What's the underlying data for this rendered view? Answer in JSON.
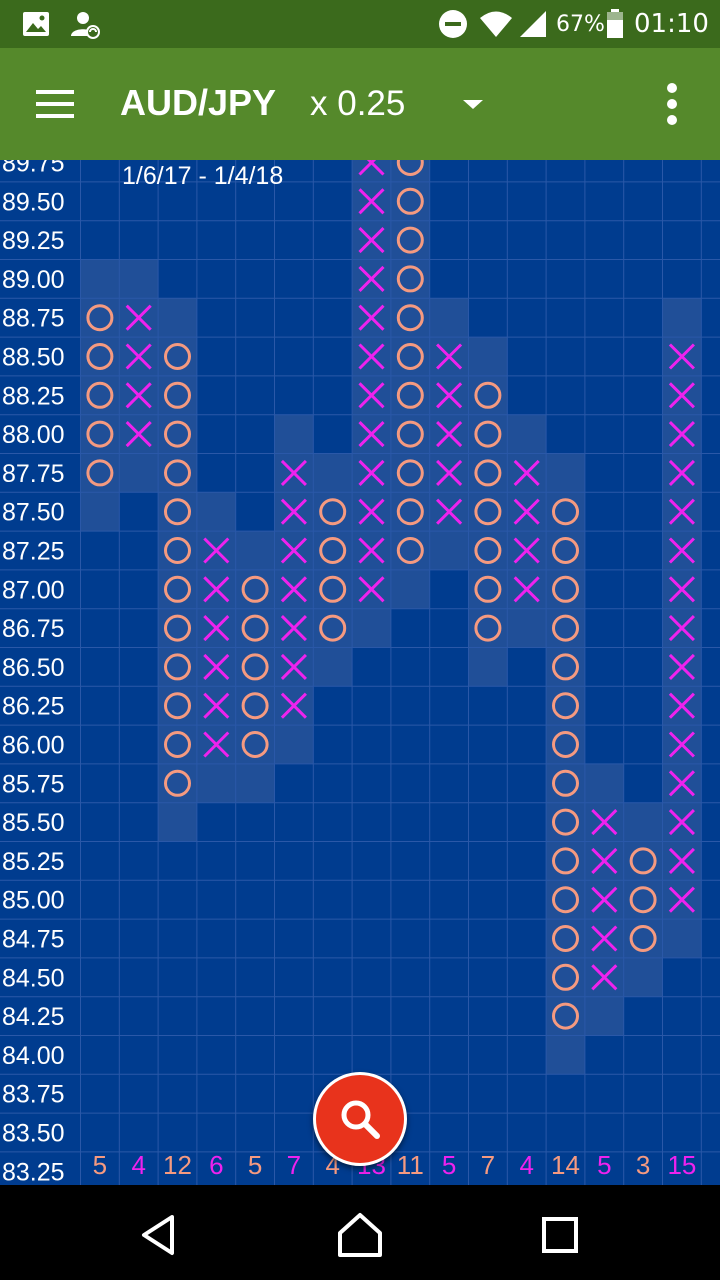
{
  "status_bar": {
    "battery_percent": "67%",
    "time": "01:10",
    "icons": [
      "image-icon",
      "sync-person-icon",
      "dnd-icon",
      "wifi-icon",
      "signal-icon",
      "battery-icon"
    ]
  },
  "app_bar": {
    "symbol": "AUD/JPY",
    "multiplier": "x 0.25",
    "menu_icon": "hamburger-icon",
    "dropdown_icon": "dropdown-arrow-icon",
    "overflow_icon": "more-vert-icon"
  },
  "chart": {
    "date_range": "1/6/17 - 1/4/18",
    "colors": {
      "background": "#003c8f",
      "x_mark": "#ee22ee",
      "o_mark": "#f59a80",
      "highlight": "#3b5fa0",
      "grid": "#2a58a8"
    }
  },
  "chart_data": {
    "type": "point-and-figure",
    "box_size": 0.25,
    "y_labels": [
      "89.75",
      "89.50",
      "89.25",
      "89.00",
      "88.75",
      "88.50",
      "88.25",
      "88.00",
      "87.75",
      "87.50",
      "87.25",
      "87.00",
      "86.75",
      "86.50",
      "86.25",
      "86.00",
      "85.75",
      "85.50",
      "85.25",
      "85.00",
      "84.75",
      "84.50",
      "84.25",
      "84.00",
      "83.75",
      "83.50",
      "83.25"
    ],
    "columns": [
      {
        "type": "O",
        "high": 88.75,
        "low": 87.75,
        "count_label": "5",
        "label_color": "#f59a80"
      },
      {
        "type": "X",
        "high": 88.75,
        "low": 88.0,
        "count_label": "4",
        "label_color": "#ee22ee"
      },
      {
        "type": "O",
        "high": 88.5,
        "low": 85.75,
        "count_label": "12",
        "label_color": "#f59a80"
      },
      {
        "type": "X",
        "high": 87.25,
        "low": 86.0,
        "count_label": "6",
        "label_color": "#ee22ee"
      },
      {
        "type": "O",
        "high": 87.0,
        "low": 86.0,
        "count_label": "5",
        "label_color": "#f59a80"
      },
      {
        "type": "X",
        "high": 87.75,
        "low": 86.25,
        "count_label": "7",
        "label_color": "#ee22ee"
      },
      {
        "type": "O",
        "high": 87.5,
        "low": 86.75,
        "count_label": "4",
        "label_color": "#f59a80"
      },
      {
        "type": "X",
        "high": 89.75,
        "low": 87.0,
        "count_label": "13",
        "label_color": "#ee22ee"
      },
      {
        "type": "O",
        "high": 89.75,
        "low": 87.25,
        "count_label": "11",
        "label_color": "#f59a80"
      },
      {
        "type": "X",
        "high": 88.5,
        "low": 87.5,
        "count_label": "5",
        "label_color": "#ee22ee"
      },
      {
        "type": "O",
        "high": 88.25,
        "low": 86.75,
        "count_label": "7",
        "label_color": "#f59a80"
      },
      {
        "type": "X",
        "high": 87.75,
        "low": 87.0,
        "count_label": "4",
        "label_color": "#ee22ee"
      },
      {
        "type": "O",
        "high": 87.5,
        "low": 84.25,
        "count_label": "14",
        "label_color": "#f59a80"
      },
      {
        "type": "X",
        "high": 85.5,
        "low": 84.5,
        "count_label": "5",
        "label_color": "#ee22ee"
      },
      {
        "type": "O",
        "high": 85.25,
        "low": 84.75,
        "count_label": "3",
        "label_color": "#f59a80"
      },
      {
        "type": "X",
        "high": 88.5,
        "low": 85.0,
        "count_label": "15",
        "label_color": "#ee22ee"
      }
    ]
  },
  "search_fab": {
    "icon": "search-icon"
  },
  "nav_bar": {
    "icons": [
      "back-icon",
      "home-icon",
      "recents-icon"
    ]
  }
}
